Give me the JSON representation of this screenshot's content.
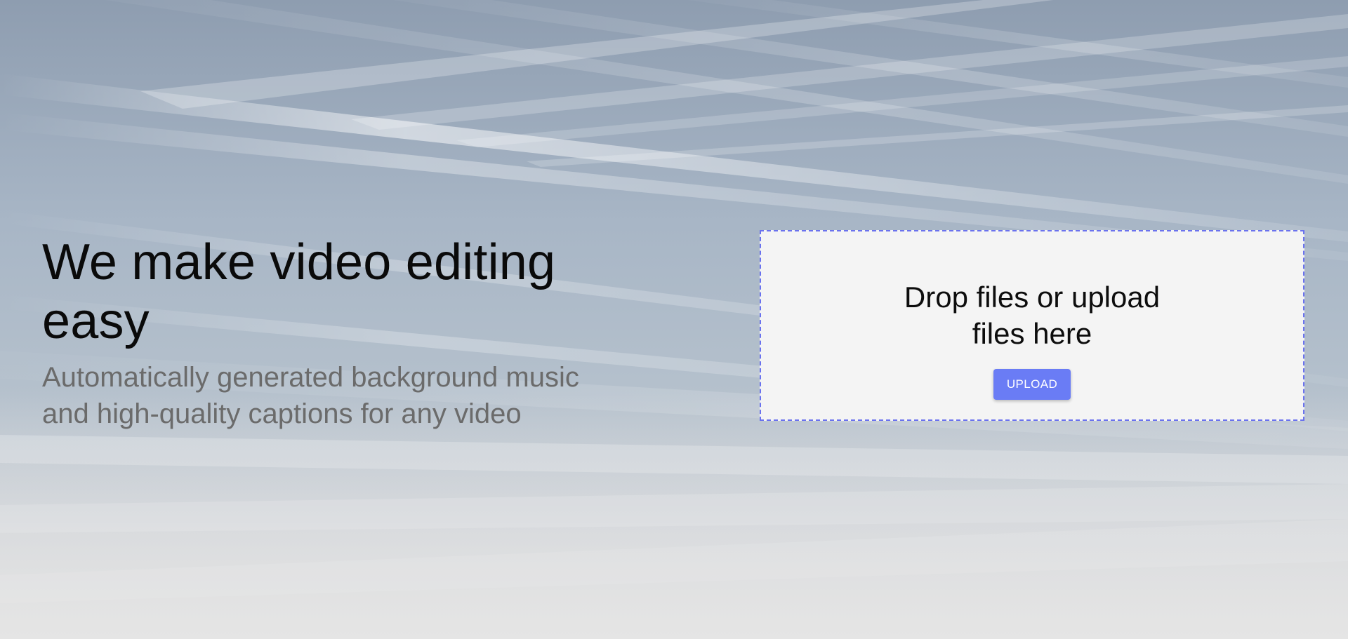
{
  "hero": {
    "title": "We make video editing easy",
    "subtitle": "Automatically generated background music and high-quality captions for any video"
  },
  "dropzone": {
    "prompt": "Drop files or upload files here",
    "upload_label": "UPLOAD"
  },
  "colors": {
    "accent": "#6a7cf5",
    "dropzone_border": "#6a72ee",
    "dropzone_background": "#f4f4f4",
    "subtitle_text": "#6b6b6b"
  }
}
